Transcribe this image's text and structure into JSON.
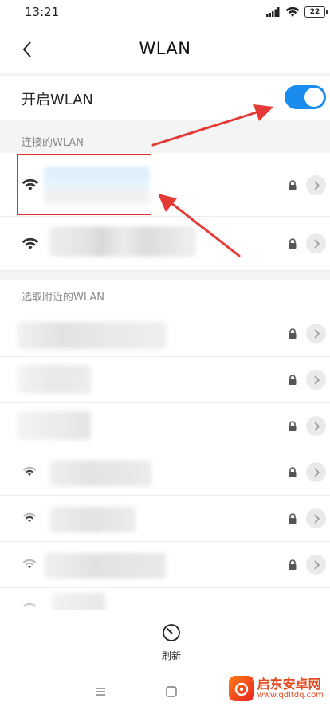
{
  "status_bar": {
    "time": "13:21",
    "battery": "22",
    "icons": [
      "signal-icon",
      "wifi-icon",
      "battery-icon"
    ]
  },
  "nav": {
    "title": "WLAN",
    "back_icon": "chevron-left-icon"
  },
  "wlan_toggle": {
    "label": "开启WLAN",
    "enabled": true,
    "color": "#1a8cf0"
  },
  "connected_section": {
    "header": "连接的WLAN",
    "networks": [
      {
        "ssid_visible": false,
        "locked": true,
        "icon": "wifi-icon"
      },
      {
        "ssid_visible": false,
        "locked": true,
        "icon": "wifi-icon"
      }
    ]
  },
  "nearby_section": {
    "header": "选取附近的WLAN",
    "networks": [
      {
        "ssid_visible": false,
        "locked": true
      },
      {
        "ssid_visible": false,
        "locked": true
      },
      {
        "ssid_visible": false,
        "locked": true
      },
      {
        "ssid_visible": false,
        "locked": true,
        "icon": "wifi-icon"
      },
      {
        "ssid_visible": false,
        "locked": true,
        "icon": "wifi-icon"
      },
      {
        "ssid_visible": false,
        "locked": true,
        "icon": "wifi-icon"
      },
      {
        "ssid_visible": false,
        "locked": false,
        "icon": "wifi-icon"
      }
    ]
  },
  "bottom_bar": {
    "refresh_label": "刷新",
    "refresh_icon": "refresh-icon"
  },
  "system_nav": {
    "icons": [
      "menu-icon",
      "home-icon",
      "back-icon"
    ]
  },
  "watermark": {
    "title": "启东安卓网",
    "url": "www.qdltdq.com"
  },
  "annotation": {
    "box_color": "#e0302a",
    "arrow_color": "#e53935"
  }
}
